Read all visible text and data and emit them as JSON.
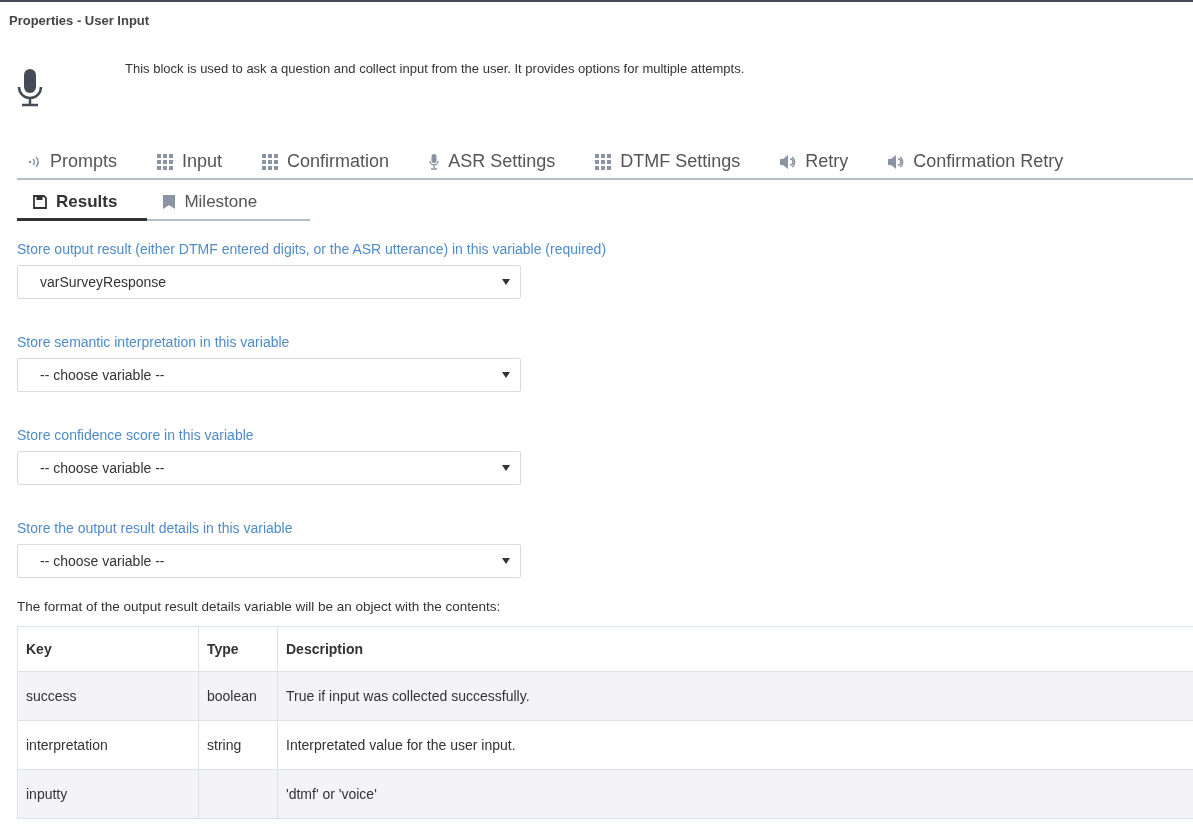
{
  "panel": {
    "title": "Properties - User Input",
    "description": "This block is used to ask a question and collect input from the user. It provides options for multiple attempts."
  },
  "tabs": [
    {
      "label": "Prompts",
      "selected": false
    },
    {
      "label": "Input",
      "selected": false
    },
    {
      "label": "Confirmation",
      "selected": false
    },
    {
      "label": "ASR Settings",
      "selected": false
    },
    {
      "label": "DTMF Settings",
      "selected": false
    },
    {
      "label": "Retry",
      "selected": false
    },
    {
      "label": "Confirmation Retry",
      "selected": false
    },
    {
      "label": "Results",
      "selected": true
    },
    {
      "label": "Milestone",
      "selected": false
    }
  ],
  "fields": [
    {
      "label": "Store output result (either DTMF entered digits, or the ASR utterance) in this variable (required)",
      "value": "varSurveyResponse"
    },
    {
      "label": "Store semantic interpretation in this variable",
      "value": "-- choose variable --"
    },
    {
      "label": "Store confidence score in this variable",
      "value": "-- choose variable --"
    },
    {
      "label": "Store the output result details in this variable",
      "value": "-- choose variable --"
    }
  ],
  "table_intro": "The format of the output result details variable will be an object with the contents:",
  "table": {
    "columns": [
      "Key",
      "Type",
      "Description"
    ],
    "rows": [
      [
        "success",
        "boolean",
        "True if input was collected successfully."
      ],
      [
        "interpretation",
        "string",
        "Interpretated value for the user input."
      ],
      [
        "inputty",
        "",
        "'dtmf' or 'voice'"
      ]
    ]
  }
}
